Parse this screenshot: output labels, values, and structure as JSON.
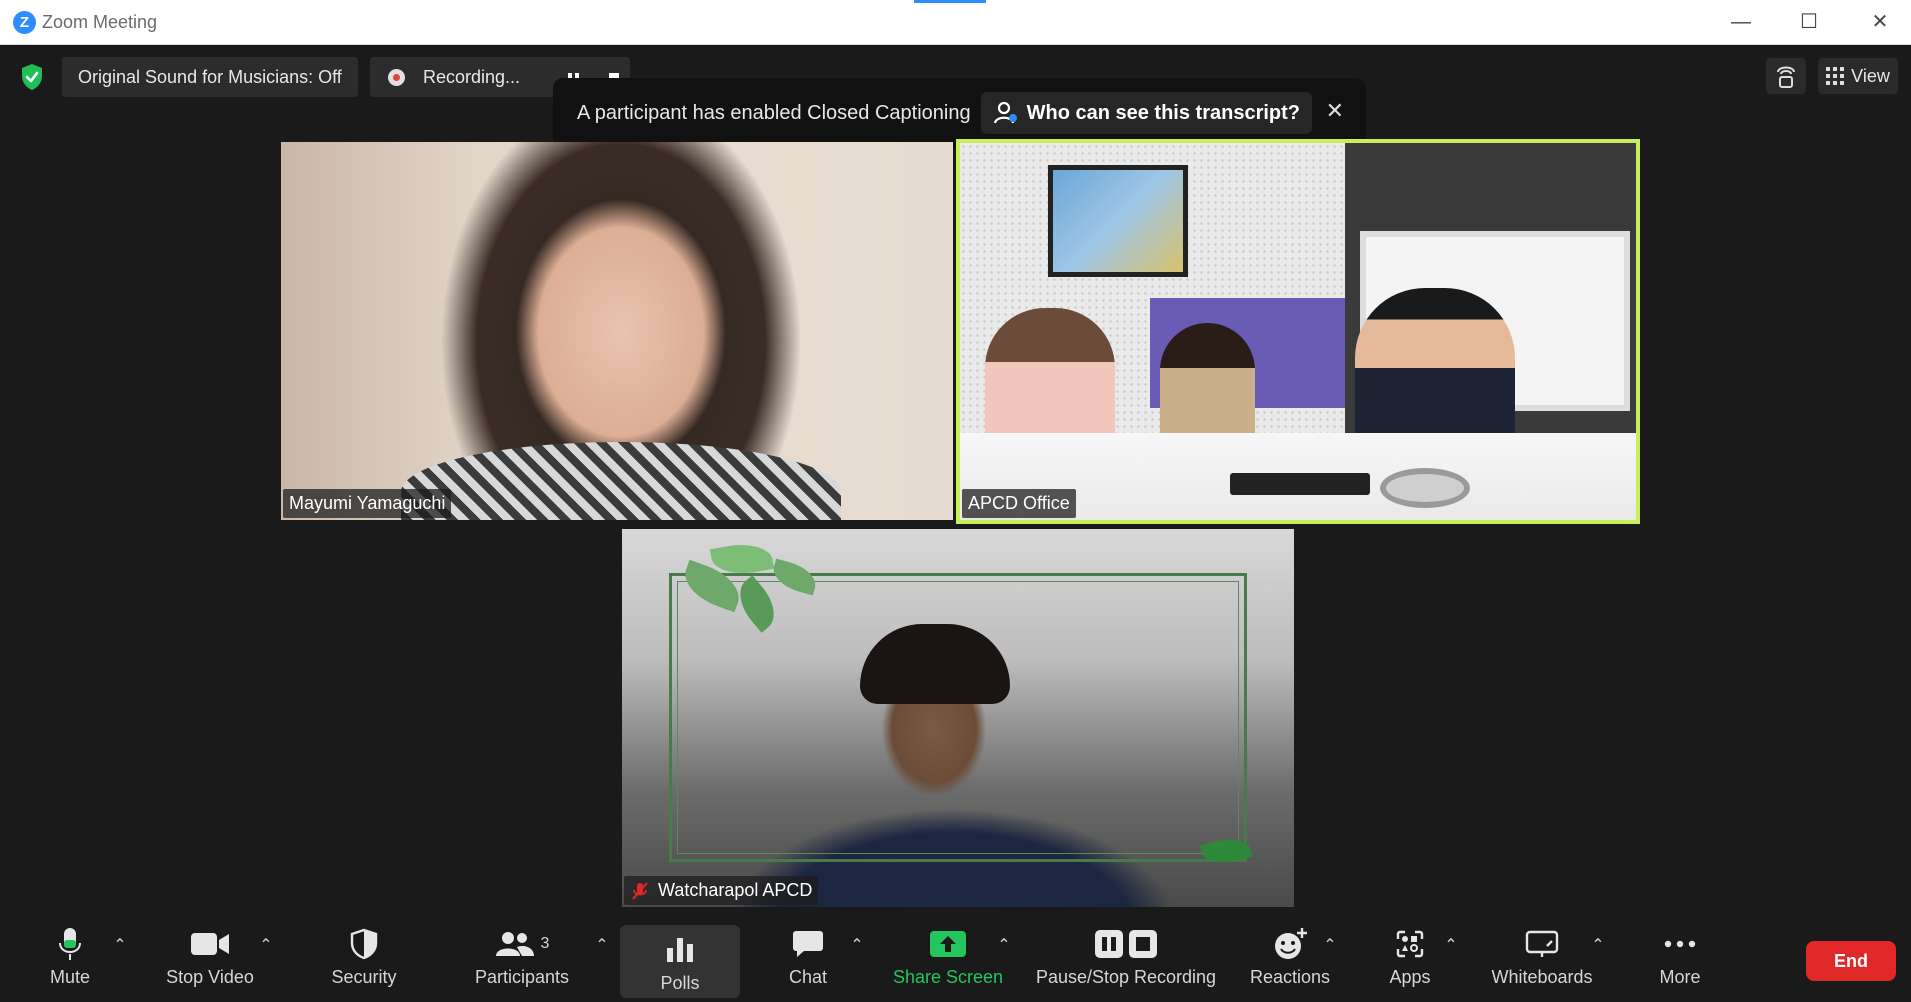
{
  "window": {
    "logo_letter": "Z",
    "title": "Zoom Meeting",
    "minimize": "—",
    "maximize": "☐",
    "close": "✕"
  },
  "meeting_bar": {
    "original_sound": "Original Sound for Musicians: Off",
    "recording_label": "Recording...",
    "caption_message": "A participant has enabled Closed Captioning",
    "who_can_see": "Who can see this transcript?",
    "caption_close": "✕",
    "view_label": "View"
  },
  "participants": [
    {
      "name": "Mayumi Yamaguchi"
    },
    {
      "name": "APCD Office"
    },
    {
      "name": "Watcharapol APCD"
    }
  ],
  "toolbar": {
    "mute": "Mute",
    "stop_video": "Stop Video",
    "security": "Security",
    "participants": "Participants",
    "participants_count": "3",
    "polls": "Polls",
    "chat": "Chat",
    "share_screen": "Share Screen",
    "pause_stop_recording": "Pause/Stop Recording",
    "reactions": "Reactions",
    "apps": "Apps",
    "whiteboards": "Whiteboards",
    "more": "More",
    "end": "End"
  },
  "colors": {
    "accent": "#2d8cff",
    "active_speaker_border": "#c6ef5b",
    "share_green": "#23c55e",
    "end_red": "#e02828",
    "secure_green": "#1fbf55"
  }
}
